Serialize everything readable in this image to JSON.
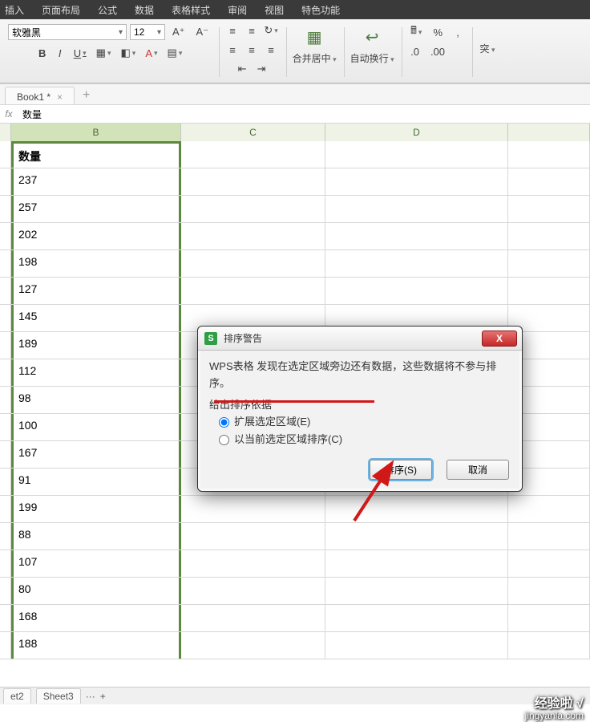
{
  "menu": {
    "insert": "插入",
    "layout": "页面布局",
    "formula": "公式",
    "data": "数据",
    "style": "表格样式",
    "review": "审阅",
    "view": "视图",
    "special": "特色功能"
  },
  "ribbon": {
    "fontname": "软雅黑",
    "fontsize": "12",
    "aplus": "A⁺",
    "aminus": "A⁻",
    "b": "B",
    "i": "I",
    "u": "U",
    "merge": "合并居中",
    "wrap": "自动换行",
    "pct": "%",
    "comma": ",",
    "dec_inc": ".0←",
    "dec_dec": ".00→",
    "break": "突"
  },
  "tabs": {
    "doc": "Book1 *",
    "close": "×",
    "add": "+"
  },
  "fbar": {
    "fx": "fx",
    "value": "数量"
  },
  "grid": {
    "cols": {
      "B": "B",
      "C": "C",
      "D": "D",
      "E": ""
    },
    "header": "数量",
    "rows": [
      "237",
      "257",
      "202",
      "198",
      "127",
      "145",
      "189",
      "112",
      "98",
      "100",
      "167",
      "91",
      "199",
      "88",
      "107",
      "80",
      "168",
      "188"
    ]
  },
  "dialog": {
    "title": "排序警告",
    "msg": "WPS表格 发现在选定区域旁边还有数据，这些数据将不参与排序。",
    "prompt": "给出排序依据",
    "opt1": "扩展选定区域(E)",
    "opt2": "以当前选定区域排序(C)",
    "sort": "排序(S)",
    "cancel": "取消",
    "x": "X",
    "logo": "S"
  },
  "sheets": {
    "s2": "et2",
    "s3": "Sheet3",
    "more": "···",
    "add": "+"
  },
  "watermark": {
    "line1": "经验啦 √",
    "line2": "jingyanla.com"
  }
}
